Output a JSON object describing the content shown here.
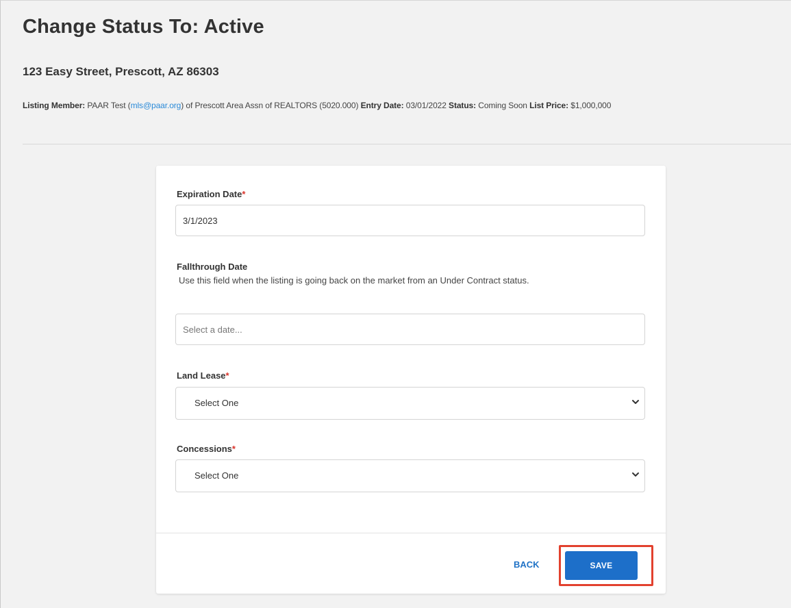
{
  "header": {
    "title": "Change Status To: Active",
    "address": "123 Easy Street, Prescott, AZ 86303"
  },
  "listing": {
    "member_label": "Listing Member:",
    "member_name": "PAAR Test (",
    "member_email": "mls@paar.org",
    "member_org": ") of Prescott Area Assn of REALTORS (5020.000)",
    "entry_date_label": "Entry Date:",
    "entry_date": "03/01/2022",
    "status_label": "Status:",
    "status": "Coming Soon",
    "list_price_label": "List Price:",
    "list_price": "$1,000,000"
  },
  "form": {
    "required_marker": "*",
    "expiration": {
      "label": "Expiration Date",
      "value": "3/1/2023"
    },
    "fallthrough": {
      "label": "Fallthrough Date",
      "help": "Use this field when the listing is going back on the market from an Under Contract status.",
      "placeholder": "Select a date..."
    },
    "land_lease": {
      "label": "Land Lease",
      "selected": "Select One"
    },
    "concessions": {
      "label": "Concessions",
      "selected": "Select One"
    }
  },
  "footer": {
    "back_label": "BACK",
    "save_label": "SAVE"
  },
  "colors": {
    "accent": "#1d6fc9",
    "required": "#d9342b",
    "highlight": "#e2412e",
    "link": "#2a8ad8"
  }
}
